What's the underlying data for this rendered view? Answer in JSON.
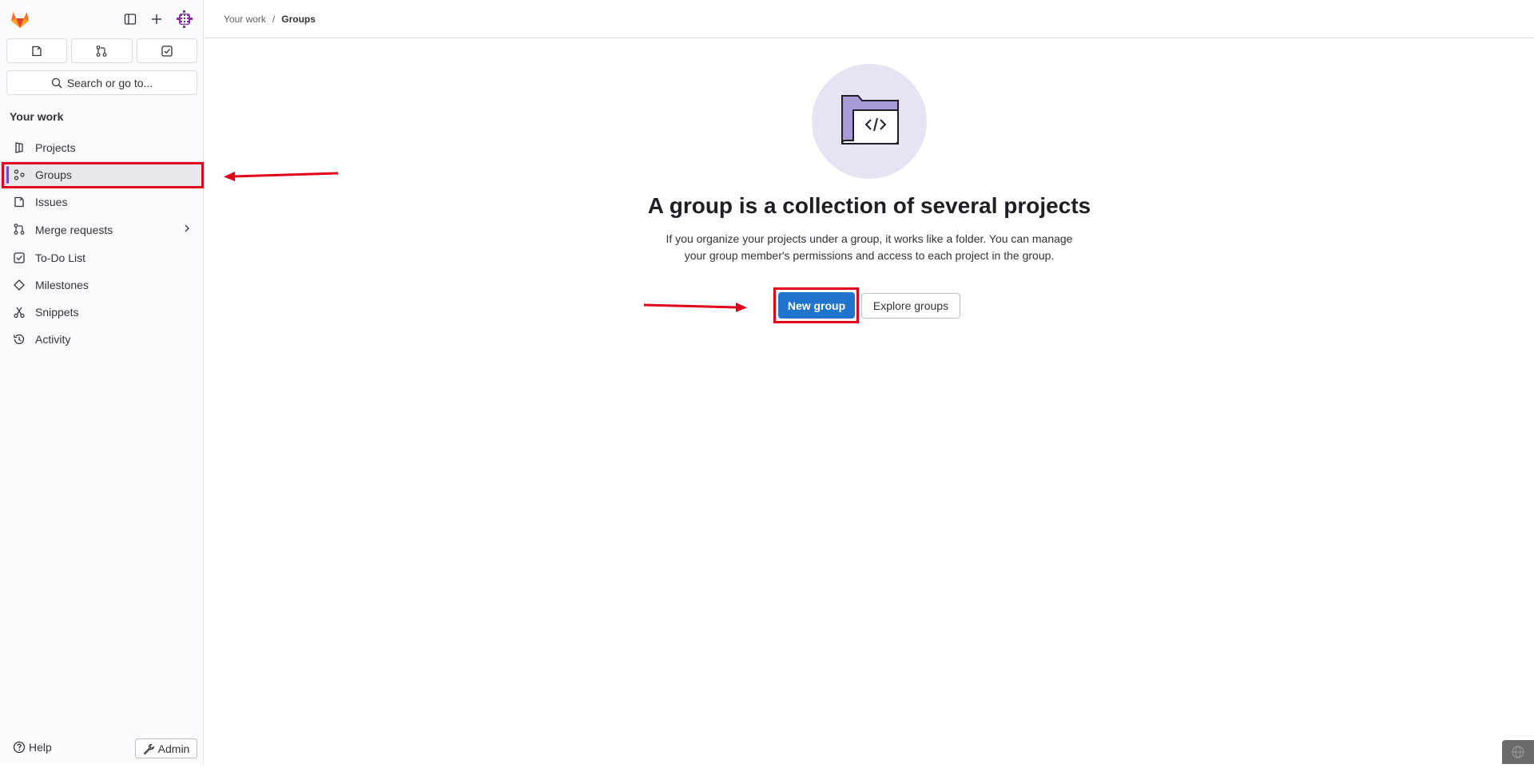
{
  "sidebar": {
    "search_placeholder": "Search or go to...",
    "section_title": "Your work",
    "items": [
      {
        "label": "Projects",
        "icon": "project-icon"
      },
      {
        "label": "Groups",
        "icon": "group-icon",
        "active": true
      },
      {
        "label": "Issues",
        "icon": "issues-icon"
      },
      {
        "label": "Merge requests",
        "icon": "merge-request-icon",
        "has_submenu": true
      },
      {
        "label": "To-Do List",
        "icon": "todo-icon"
      },
      {
        "label": "Milestones",
        "icon": "milestone-icon"
      },
      {
        "label": "Snippets",
        "icon": "snippet-icon"
      },
      {
        "label": "Activity",
        "icon": "history-icon"
      }
    ],
    "help_label": "Help",
    "admin_label": "Admin"
  },
  "breadcrumb": {
    "parent": "Your work",
    "separator": "/",
    "current": "Groups"
  },
  "empty_state": {
    "title": "A group is a collection of several projects",
    "description": "If you organize your projects under a group, it works like a folder. You can manage your group member's permissions and access to each project in the group.",
    "primary_button": "New group",
    "secondary_button": "Explore groups"
  },
  "colors": {
    "accent": "#1f75cb",
    "highlight": "#e0001b",
    "active_indicator": "#6e49cb"
  }
}
